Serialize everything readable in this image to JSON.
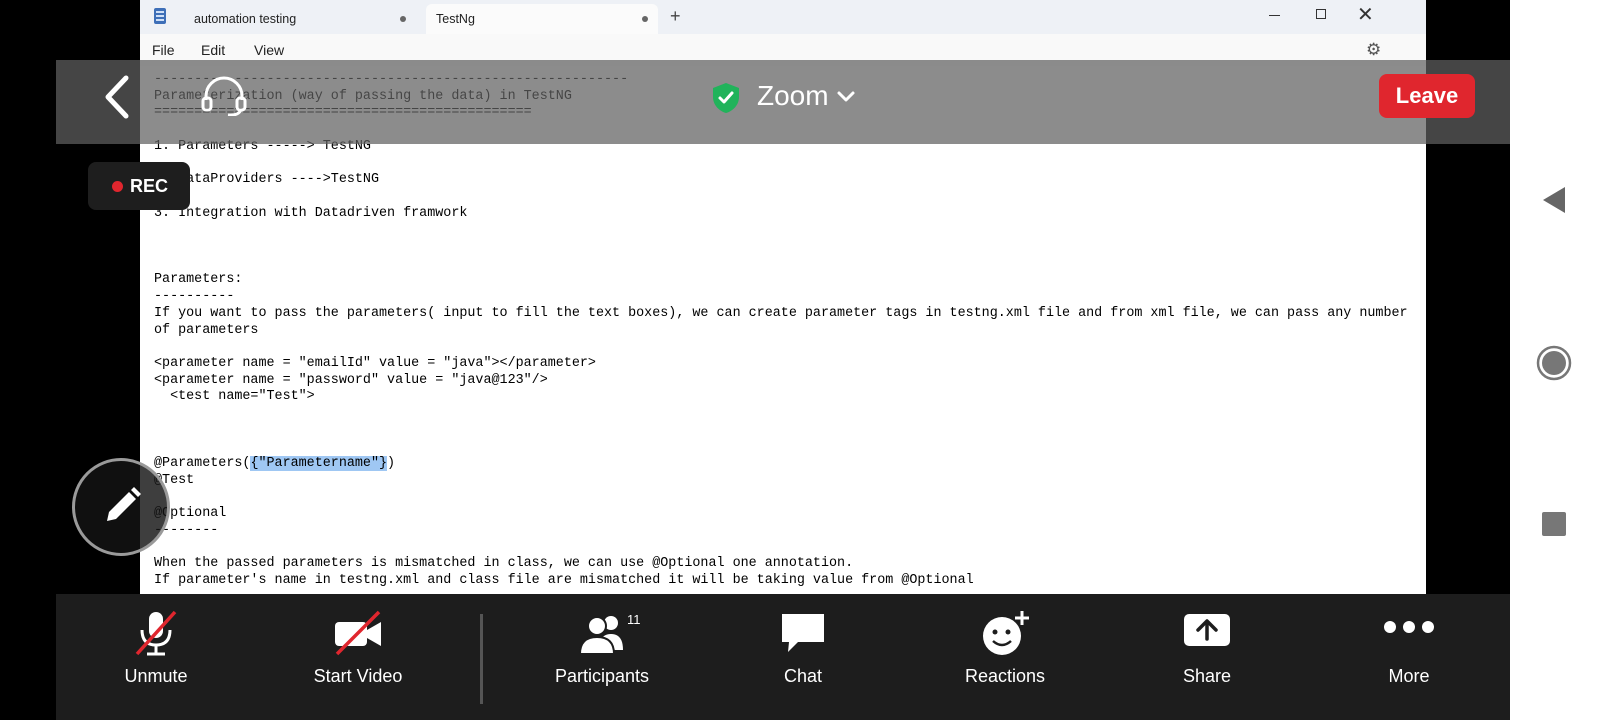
{
  "notepad": {
    "tabs": [
      {
        "label": "automation testing",
        "active": false
      },
      {
        "label": "TestNg",
        "active": true
      }
    ],
    "menu": [
      "File",
      "Edit",
      "View"
    ],
    "document": {
      "lines_before": [
        "-----------------------------------------------------------",
        "Parameterization (way of passing the data) in TestNG",
        "===============================================",
        "",
        "1. Parameters -----> TestNG",
        "",
        "2. DataProviders ---->TestNG",
        "",
        "3. Integration with Datadriven framwork",
        "",
        "",
        "",
        "Parameters:",
        "----------",
        "If you want to pass the parameters( input to fill the text boxes), we can create parameter tags in testng.xml file and from xml file, we can pass any number",
        "of parameters",
        "",
        "<parameter name = \"emailId\" value = \"java\"></parameter>",
        "<parameter name = \"password\" value = \"java@123\"/>",
        "  <test name=\"Test\">",
        "",
        "",
        ""
      ],
      "highlight_prefix": "@Parameters(",
      "highlight_text": "{\"Parametername\"}",
      "highlight_suffix": ")",
      "lines_after": [
        "@Test",
        "",
        "@Optional",
        "--------",
        "",
        "When the passed parameters is mismatched in class, we can use @Optional one annotation.",
        "If parameter's name in testng.xml and class file are mismatched it will be taking value from @Optional"
      ]
    }
  },
  "zoom": {
    "title": "Zoom",
    "leave_label": "Leave",
    "rec_label": "REC",
    "toolbar": [
      {
        "label": "Unmute",
        "icon": "mic-off-icon"
      },
      {
        "label": "Start Video",
        "icon": "video-off-icon"
      },
      {
        "label": "Participants",
        "icon": "participants-icon",
        "badge": "11"
      },
      {
        "label": "Chat",
        "icon": "chat-icon"
      },
      {
        "label": "Reactions",
        "icon": "reactions-icon"
      },
      {
        "label": "Share",
        "icon": "share-icon"
      },
      {
        "label": "More",
        "icon": "more-icon"
      }
    ],
    "colors": {
      "leave": "#e0262e",
      "shield": "#21b35b",
      "rec_dot": "#e0262e",
      "muted_slash": "#e0262e",
      "highlight": "#9fc7f3"
    }
  }
}
